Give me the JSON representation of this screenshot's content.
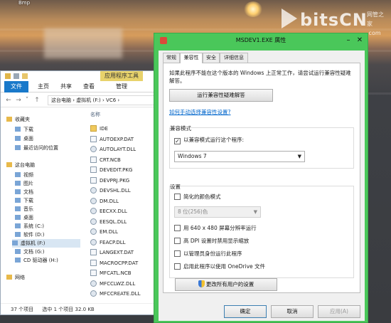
{
  "desktop": {
    "label": "Bmp"
  },
  "watermark": {
    "brand": "bitsCN",
    "line1": "网管之家",
    "line2": ".com"
  },
  "explorer": {
    "contextual_tab": "应用程序工具",
    "tabs": [
      "文件",
      "主页",
      "共享",
      "查看",
      "管理"
    ],
    "address": "这台电脑 › 虚拟机 (F:) › VC6 ›",
    "nav_items": [
      {
        "label": "收藏夹",
        "indent": 0
      },
      {
        "label": "下载",
        "indent": 1
      },
      {
        "label": "桌面",
        "indent": 1
      },
      {
        "label": "最近访问的位置",
        "indent": 1
      },
      {
        "label": "这台电脑",
        "indent": 0
      },
      {
        "label": "视频",
        "indent": 1
      },
      {
        "label": "图片",
        "indent": 1
      },
      {
        "label": "文档",
        "indent": 1
      },
      {
        "label": "下载",
        "indent": 1
      },
      {
        "label": "音乐",
        "indent": 1
      },
      {
        "label": "桌面",
        "indent": 1
      },
      {
        "label": "系统 (C:)",
        "indent": 1
      },
      {
        "label": "软件 (D:)",
        "indent": 1
      },
      {
        "label": "虚拟机 (F:)",
        "indent": 1,
        "selected": true
      },
      {
        "label": "文档 (G:)",
        "indent": 1
      },
      {
        "label": "CD 驱动器 (H:)",
        "indent": 1
      },
      {
        "label": "网络",
        "indent": 0
      }
    ],
    "column_header": "名称",
    "files": [
      {
        "name": "IDE",
        "icon": "folder"
      },
      {
        "name": "AUTOEXP.DAT",
        "icon": "file"
      },
      {
        "name": "AUTOLAYT.DLL",
        "icon": "gear"
      },
      {
        "name": "CRT.NCB",
        "icon": "file"
      },
      {
        "name": "DEVEDIT.PKG",
        "icon": "file"
      },
      {
        "name": "DEVPRJ.PKG",
        "icon": "file"
      },
      {
        "name": "DEVSHL.DLL",
        "icon": "gear"
      },
      {
        "name": "DM.DLL",
        "icon": "gear"
      },
      {
        "name": "EECXX.DLL",
        "icon": "gear"
      },
      {
        "name": "EESQL.DLL",
        "icon": "gear"
      },
      {
        "name": "EM.DLL",
        "icon": "gear"
      },
      {
        "name": "FEACP.DLL",
        "icon": "gear"
      },
      {
        "name": "LANGEXT.DAT",
        "icon": "file"
      },
      {
        "name": "MACROCPP.DAT",
        "icon": "file"
      },
      {
        "name": "MFCATL.NCB",
        "icon": "file"
      },
      {
        "name": "MFCCLWZ.DLL",
        "icon": "gear"
      },
      {
        "name": "MFCCREATE.DLL",
        "icon": "gear"
      }
    ],
    "status": {
      "count": "37 个项目",
      "selected": "选中 1 个项目  32.0 KB"
    }
  },
  "dialog": {
    "title": "MSDEV1.EXE 属性",
    "tabs": [
      "常规",
      "兼容性",
      "安全",
      "详细信息"
    ],
    "active_tab": 1,
    "intro": "如果此程序不能在这个版本的 Windows 上正常工作，请尝试运行兼容性疑难解答。",
    "troubleshoot_button": "运行兼容性疑难解答",
    "manual_link": "如何手动选择兼容性设置?",
    "compat_mode": {
      "label": "兼容模式",
      "checkbox": "以兼容模式运行这个程序:",
      "checked": true,
      "selected_os": "Windows 7"
    },
    "settings": {
      "label": "设置",
      "reduced_color": "简化的颜色模式",
      "color_value": "8 位(256)色",
      "options": [
        "用 640 x 480 屏幕分辨率运行",
        "高 DPI 设置时禁用显示缩放",
        "以管理员身份运行此程序",
        "启用此程序以使用 OneDrive 文件"
      ]
    },
    "all_users_button": "更改所有用户的设置",
    "footer": {
      "ok": "确定",
      "cancel": "取消",
      "apply": "应用(A)"
    }
  }
}
